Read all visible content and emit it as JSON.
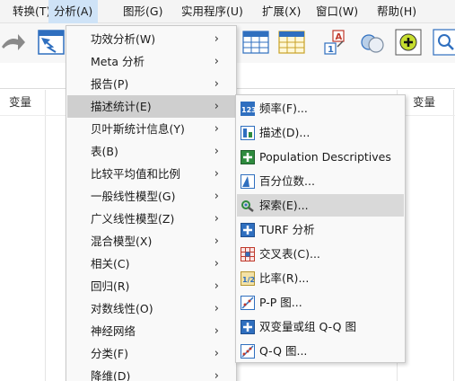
{
  "menubar": {
    "items": [
      {
        "label": "转换(T)"
      },
      {
        "label": "分析(A)"
      },
      {
        "label": "图形(G)"
      },
      {
        "label": "实用程序(U)"
      },
      {
        "label": "扩展(X)"
      },
      {
        "label": "窗口(W)"
      },
      {
        "label": "帮助(H)"
      }
    ]
  },
  "grid": {
    "column_header_left": "变量",
    "column_header_right": "变量"
  },
  "analyze_menu": {
    "items": [
      {
        "label": "功效分析(W)"
      },
      {
        "label": "Meta 分析"
      },
      {
        "label": "报告(P)"
      },
      {
        "label": "描述统计(E)"
      },
      {
        "label": "贝叶斯统计信息(Y)"
      },
      {
        "label": "表(B)"
      },
      {
        "label": "比较平均值和比例"
      },
      {
        "label": "一般线性模型(G)"
      },
      {
        "label": "广义线性模型(Z)"
      },
      {
        "label": "混合模型(X)"
      },
      {
        "label": "相关(C)"
      },
      {
        "label": "回归(R)"
      },
      {
        "label": "对数线性(O)"
      },
      {
        "label": "神经网络"
      },
      {
        "label": "分类(F)"
      },
      {
        "label": "降维(D)"
      }
    ],
    "active_index": 3,
    "submenu_arrow": "›"
  },
  "descriptive_submenu": {
    "items": [
      {
        "label": "频率(F)...",
        "icon": "frequencies-icon"
      },
      {
        "label": "描述(D)...",
        "icon": "descriptives-icon"
      },
      {
        "label": "Population Descriptives",
        "icon": "population-descriptives-icon"
      },
      {
        "label": "百分位数...",
        "icon": "percentiles-icon"
      },
      {
        "label": "探索(E)...",
        "icon": "explore-icon"
      },
      {
        "label": "TURF 分析",
        "icon": "turf-icon"
      },
      {
        "label": "交叉表(C)...",
        "icon": "crosstabs-icon"
      },
      {
        "label": "比率(R)...",
        "icon": "ratio-icon"
      },
      {
        "label": "P-P 图...",
        "icon": "pp-plot-icon"
      },
      {
        "label": "双变量或组 Q-Q 图",
        "icon": "bivariate-qq-icon"
      },
      {
        "label": "Q-Q 图...",
        "icon": "qq-plot-icon"
      }
    ],
    "active_index": 4
  },
  "colors": {
    "menu_bg": "#f9f9f9",
    "highlight_main": "#cfcfcf",
    "highlight_sub": "#d9d9d9",
    "menubar_active": "#cfe3f7",
    "icon_blue": "#2f6fbf",
    "icon_green": "#2e8b3e"
  }
}
